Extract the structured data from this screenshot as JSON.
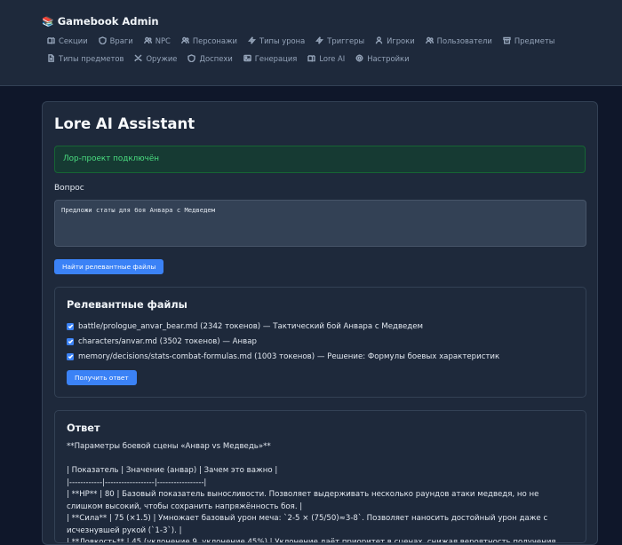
{
  "app": {
    "title": "Gamebook Admin",
    "logo_icon": "books-icon"
  },
  "nav": [
    {
      "label": "Секции",
      "icon": "book-icon"
    },
    {
      "label": "Враги",
      "icon": "shield-icon"
    },
    {
      "label": "NPC",
      "icon": "users-icon"
    },
    {
      "label": "Персонажи",
      "icon": "users-icon"
    },
    {
      "label": "Типы урона",
      "icon": "zap-icon"
    },
    {
      "label": "Триггеры",
      "icon": "zap-icon"
    },
    {
      "label": "Игроки",
      "icon": "user-icon"
    },
    {
      "label": "Пользователи",
      "icon": "users-icon"
    },
    {
      "label": "Предметы",
      "icon": "box-icon"
    },
    {
      "label": "Типы предметов",
      "icon": "file-icon"
    },
    {
      "label": "Оружие",
      "icon": "swords-icon"
    },
    {
      "label": "Доспехи",
      "icon": "shield-icon"
    },
    {
      "label": "Генерация",
      "icon": "image-icon"
    },
    {
      "label": "Lore AI",
      "icon": "book-icon"
    },
    {
      "label": "Настройки",
      "icon": "gear-icon"
    }
  ],
  "main": {
    "title": "Lore AI Assistant",
    "status": "Лор-проект подключён",
    "question_label": "Вопрос",
    "question_value": "Предложи статы для боя Анвара с Медведем",
    "find_button": "Найти релевантные файлы",
    "files_title": "Релевантные файлы",
    "files": [
      {
        "label": "battle/prologue_anvar_bear.md (2342 токенов) — Тактический бой Анвара с Медведем",
        "checked": true
      },
      {
        "label": "characters/anvar.md (3502 токенов) — Анвар",
        "checked": true
      },
      {
        "label": "memory/decisions/stats-combat-formulas.md (1003 токенов) — Решение: Формулы боевых характеристик",
        "checked": true
      }
    ],
    "get_answer_button": "Получить ответ",
    "answer_title": "Ответ",
    "answer_text": "**Параметры боевой сцены «Анвар vs Медведь»**\n\n| Показатель | Значение (анвар) | Зачем это важно |\n|------------|------------------|-----------------|\n| **HP** | 80 | Базовый показатель выносливости. Позволяет выдерживать несколько раундов атаки медведя, но не слишком высокий, чтобы сохранить напряжённость боя. |\n| **Сила** | 75 (×1.5) | Умножает базовый урон меча: `2-5 × (75/50)≈3-8`. Позволяет наносить достойный урон даже с исчезнувшей рукой (`1-3`). |\n| **Ловкость** | 45 (уклонение 9, уклонение 45%) | Уклонение даёт приоритет в сценах, снижая вероятность получения урона."
  }
}
